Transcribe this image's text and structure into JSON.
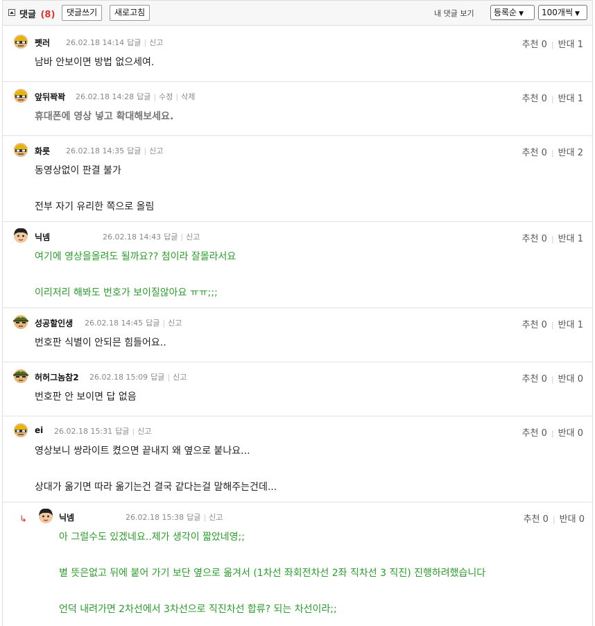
{
  "header": {
    "title": "댓글",
    "count": "(8)",
    "write_btn": "댓글쓰기",
    "refresh_btn": "새로고침",
    "my_comments": "내 댓글 보기",
    "sort_value": "등록순",
    "per_page_value": "100개씩"
  },
  "vote_labels": {
    "up": "추천",
    "down": "반대"
  },
  "comments": [
    {
      "nick": "펫러",
      "date": "26.02.18 14:14",
      "actions": [
        "답글",
        "신고"
      ],
      "up": "0",
      "down": "1",
      "body": "남바 안보이면 방법 없으세여.",
      "avatar": "yellow-helmet-avatar"
    },
    {
      "nick": "앞뒤꽉꽉",
      "date": "26.02.18 14:28",
      "actions": [
        "답글",
        "수정",
        "삭제"
      ],
      "up": "0",
      "down": "1",
      "body": "휴대폰에 영상 넣고 확대해보세요.",
      "avatar": "yellow-helmet-avatar"
    },
    {
      "nick": "화릇",
      "date": "26.02.18 14:35",
      "actions": [
        "답글",
        "신고"
      ],
      "up": "0",
      "down": "2",
      "body": "동영상없이 판결 불가\n\n전부 자기 유리한 쪽으로 올림",
      "avatar": "yellow-helmet-avatar"
    },
    {
      "nick": "닉넴",
      "date": "26.02.18 14:43",
      "actions": [
        "답글",
        "신고"
      ],
      "up": "0",
      "down": "1",
      "body": "여기에 영상을올려도 될까요?? 첨이라 잘몰라서요\n\n이리저리 해봐도 번호가 보이질않아요 ㅠㅠ;;;",
      "avatar": "boy-avatar"
    },
    {
      "nick": "성공할인생",
      "date": "26.02.18 14:45",
      "actions": [
        "답글",
        "신고"
      ],
      "up": "0",
      "down": "1",
      "body": "번호판 식별이 안되믄 힘들어요..",
      "avatar": "soldier-avatar"
    },
    {
      "nick": "허허그놈참2",
      "date": "26.02.18 15:09",
      "actions": [
        "답글",
        "신고"
      ],
      "up": "0",
      "down": "0",
      "body": "번호판 안 보이면 답 없음",
      "avatar": "soldier-avatar"
    },
    {
      "nick": "ei",
      "date": "26.02.18 15:31",
      "actions": [
        "답글",
        "신고"
      ],
      "up": "0",
      "down": "0",
      "body": "영상보니 쌍라이트 켰으면 끝내지 왜 옆으로 붙나요...\n\n상대가 옮기면 따라 옮기는건 결국 같다는걸 말해주는건데...",
      "avatar": "yellow-helmet-avatar"
    },
    {
      "nick": "닉넴",
      "date": "26.02.18 15:38",
      "actions": [
        "답글",
        "신고"
      ],
      "up": "0",
      "down": "0",
      "body": "아 그럴수도 있겠네요..제가 생각이 짧았네영;;\n\n별 뜻은없고 뒤에 붙어 가기 보단 옆으로 옮겨서 (1차선 좌회전차선 2좌 직차선 3 직진) 진행하려했습니다\n\n언덕 내려가면 2차선에서 3차선으로 직진차선 합류? 되는 차선이라;;",
      "avatar": "boy-avatar"
    }
  ],
  "colors": {
    "green_text": "#2a9d2a",
    "gray_text": "#777777",
    "count_red": "#dd3333"
  }
}
